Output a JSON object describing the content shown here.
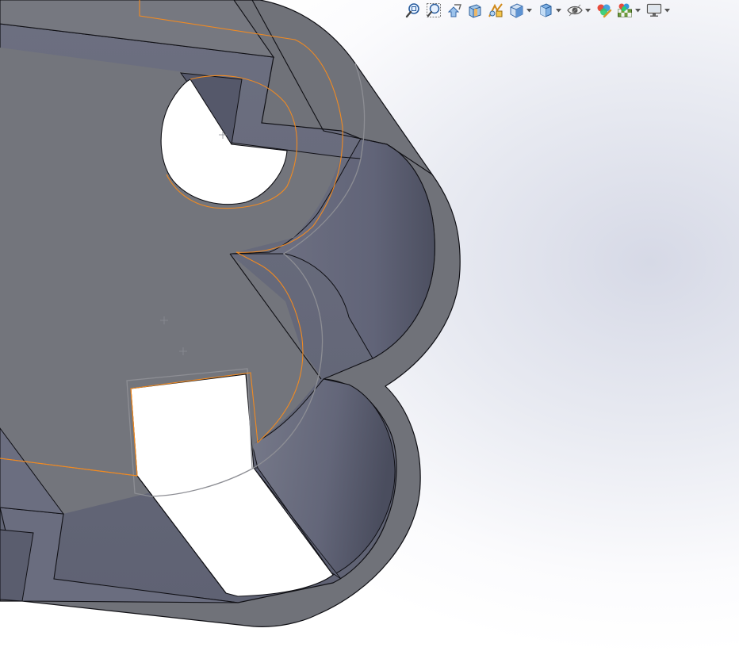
{
  "window": {
    "view": "3d-graphics-area"
  },
  "toolbar": {
    "items": [
      {
        "icon": "zoom-to-fit-icon",
        "caret": false
      },
      {
        "icon": "zoom-to-area-icon",
        "caret": false
      },
      {
        "icon": "previous-view-icon",
        "caret": false
      },
      {
        "icon": "section-view-icon",
        "caret": false
      },
      {
        "icon": "dynamic-annotation-views-icon",
        "caret": false
      },
      {
        "icon": "view-orientation-icon",
        "caret": true
      },
      {
        "icon": "display-style-icon",
        "caret": true
      },
      {
        "icon": "hide-show-items-icon",
        "caret": true
      },
      {
        "icon": "edit-appearance-icon",
        "caret": false
      },
      {
        "icon": "apply-scene-icon",
        "caret": true
      },
      {
        "icon": "view-settings-icon",
        "caret": true
      }
    ]
  },
  "colors": {
    "face_top": "#73757c",
    "face_inner": "#696c7e",
    "edge": "#101015",
    "sketch_highlight": "#f08a22",
    "tangent_edge": "#9a9a9e",
    "background_tint": "#d6d9e6"
  }
}
